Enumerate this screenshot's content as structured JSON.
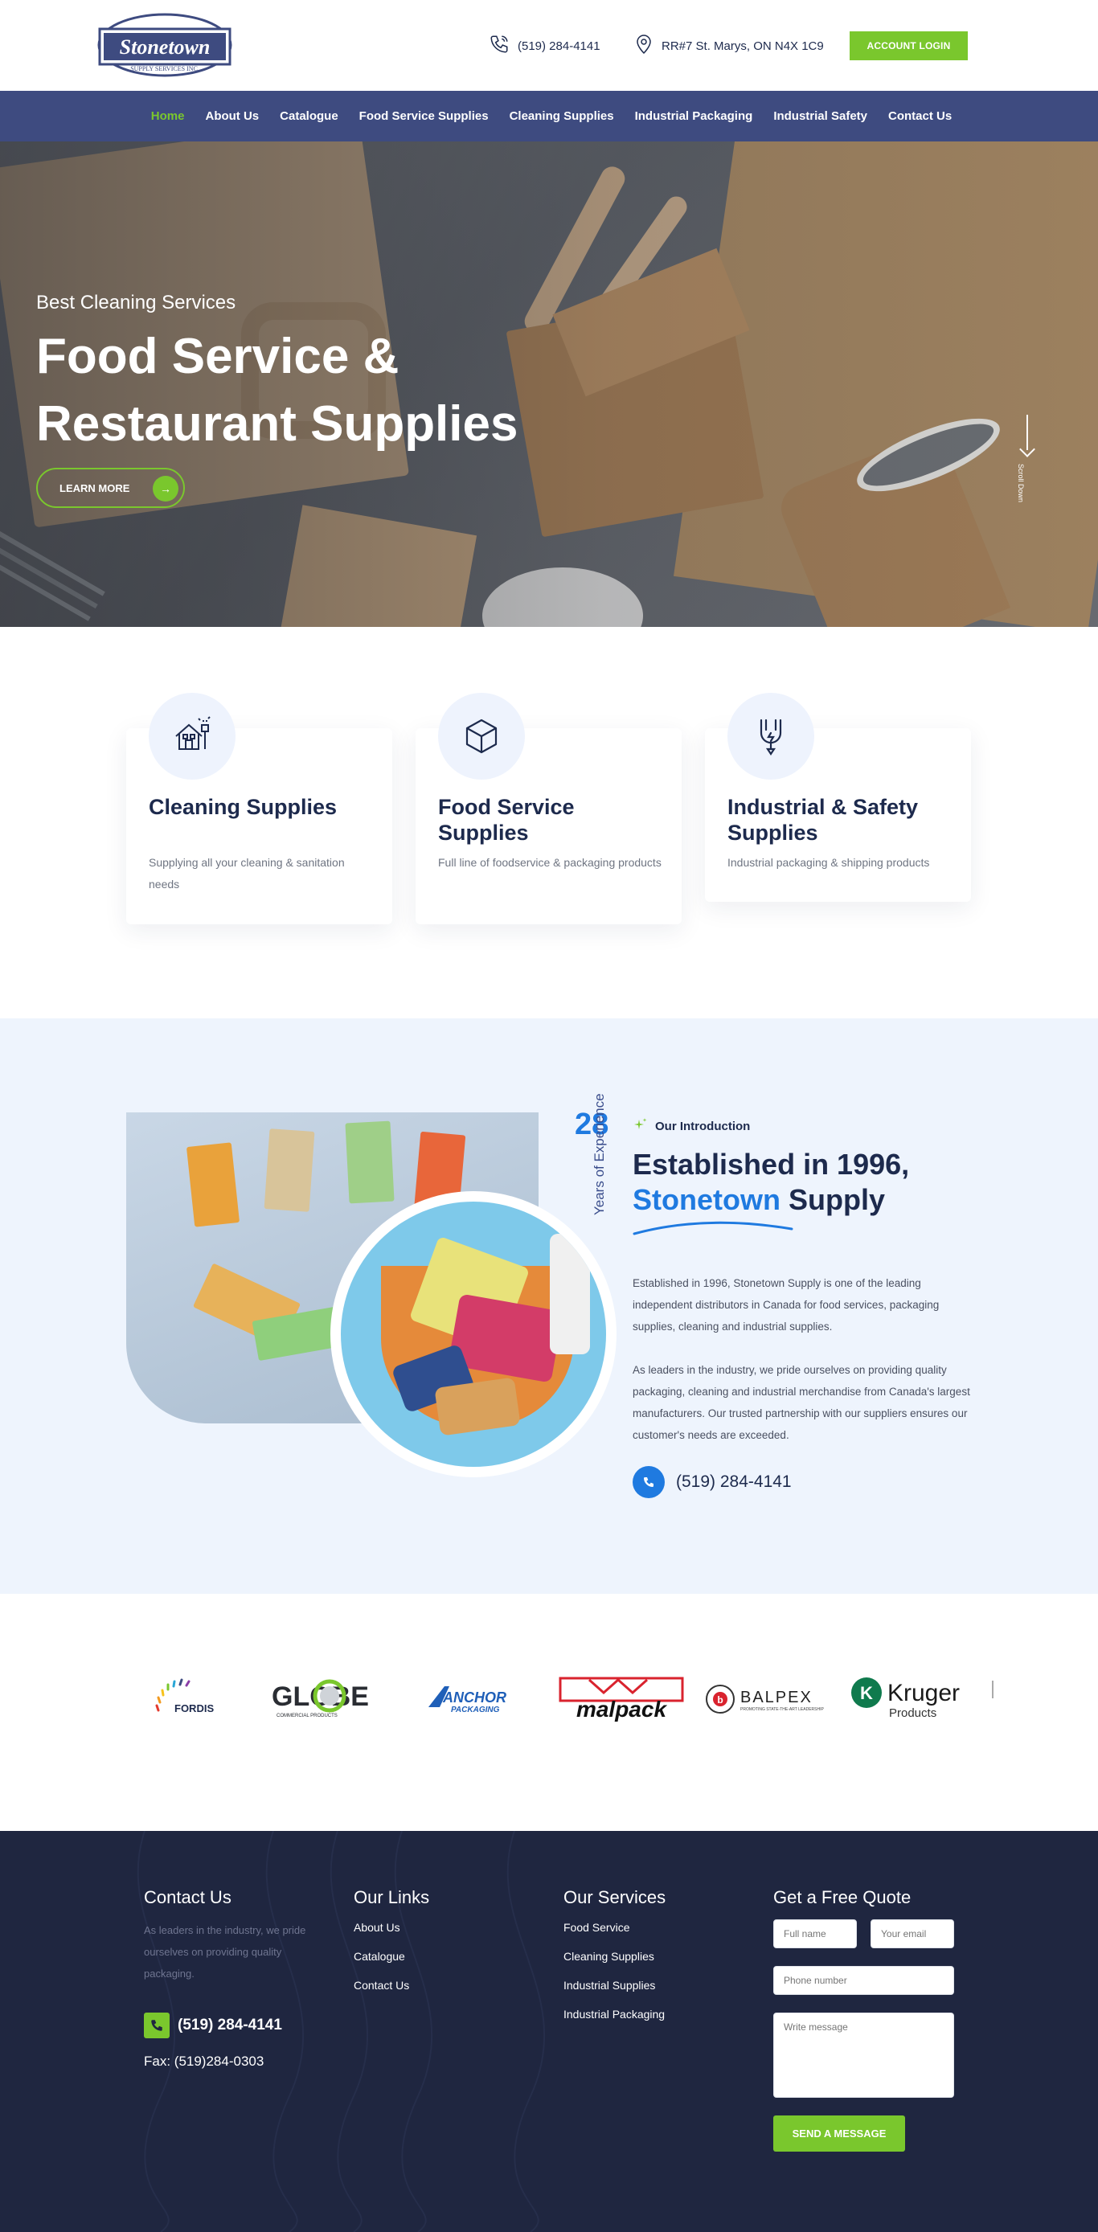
{
  "header": {
    "logo_text": "Stonetown",
    "logo_subtext": "SUPPLY SERVICES INC.",
    "phone": "(519) 284-4141",
    "address": "RR#7 St. Marys, ON N4X 1C9",
    "login_label": "ACCOUNT LOGIN"
  },
  "nav": {
    "items": [
      "Home",
      "About Us",
      "Catalogue",
      "Food Service Supplies",
      "Cleaning Supplies",
      "Industrial Packaging",
      "Industrial Safety",
      "Contact Us"
    ],
    "active": "Home"
  },
  "hero": {
    "subtitle": "Best Cleaning Services",
    "title": "Food Service & Restaurant Supplies",
    "button_label": "LEARN MORE",
    "scroll_label": "Scroll Down"
  },
  "services": [
    {
      "title": "Cleaning Supplies",
      "desc": "Supplying all your cleaning & sanitation needs",
      "icon": "house-cleaning-icon"
    },
    {
      "title": "Food Service Supplies",
      "desc": "Full line of foodservice & packaging products",
      "icon": "box-icon"
    },
    {
      "title": "Industrial & Safety Supplies",
      "desc": "Industrial packaging & shipping products",
      "icon": "plug-icon"
    }
  ],
  "intro": {
    "years_number": "28",
    "years_label": "Years of Experience",
    "kicker": "Our Introduction",
    "heading_part1": "Established in 1996,",
    "heading_accent": "Stonetown",
    "heading_part2": "Supply",
    "paragraph1": "Established in 1996, Stonetown Supply is one of the leading independent distributors in Canada for food services, packaging supplies, cleaning and industrial supplies.",
    "paragraph2": "As leaders in the industry, we pride ourselves on providing quality packaging, cleaning and industrial merchandise from Canada's largest manufacturers. Our trusted partnership with our suppliers ensures our customer's needs are exceeded.",
    "phone": "(519) 284-4141"
  },
  "brands": {
    "fordis": "FORDIS",
    "globe": "GLOBE",
    "globe_sub": "COMMERCIAL PRODUCTS",
    "anchor": "ANCHOR",
    "anchor_sub": "PACKAGING",
    "malpack": "malpack",
    "balpex": "BALPEX",
    "balpex_sub": "PROMOTING STATE-THE-ART LEADERSHIP",
    "kruger": "Kruger",
    "kruger_sub": "Products"
  },
  "footer": {
    "contact_heading": "Contact Us",
    "contact_desc": "As leaders in the industry, we pride ourselves on providing quality packaging.",
    "phone": "(519) 284-4141",
    "fax": "Fax: (519)284-0303",
    "links_heading": "Our Links",
    "links": [
      "About Us",
      "Catalogue",
      "Contact Us"
    ],
    "services_heading": "Our Services",
    "services": [
      "Food Service",
      "Cleaning Supplies",
      "Industrial Supplies",
      "Industrial Packaging"
    ],
    "quote_heading": "Get a Free Quote",
    "placeholder_name": "Full name",
    "placeholder_email": "Your email",
    "placeholder_phone": "Phone number",
    "placeholder_message": "Write message",
    "send_label": "SEND A MESSAGE"
  },
  "colors": {
    "accent_green": "#7ac72d",
    "nav_blue": "#3e4b80",
    "brand_blue": "#1f7ae0",
    "footer_bg": "#1f2640"
  }
}
